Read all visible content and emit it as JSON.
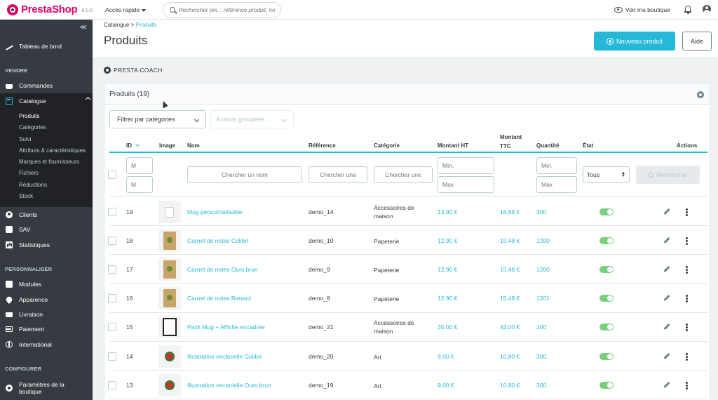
{
  "app": {
    "name": "PrestaShop",
    "version": "8.0.0"
  },
  "topbar": {
    "quick_access": "Accès rapide",
    "search_placeholder": "Rechercher (ex. : référence produit, no",
    "view_shop": "Voir ma boutique"
  },
  "sidebar": {
    "dashboard": "Tableau de bord",
    "section_sell": "VENDRE",
    "orders": "Commandes",
    "catalog": "Catalogue",
    "catalog_sub": [
      "Produits",
      "Catégories",
      "Suivi",
      "Attributs & caractéristiques",
      "Marques et fournisseurs",
      "Fichiers",
      "Réductions",
      "Stock"
    ],
    "customers": "Clients",
    "sav": "SAV",
    "stats": "Statistiques",
    "section_customize": "PERSONNALISER",
    "modules": "Modules",
    "appearance": "Apparence",
    "shipping": "Livraison",
    "payment": "Paiement",
    "international": "International",
    "section_configure": "CONFIGURER",
    "shop_params": "Paramètres de la boutique"
  },
  "header": {
    "breadcrumb_parent": "Catalogue",
    "breadcrumb_sep": ">",
    "breadcrumb_current": "Produits",
    "title": "Produits",
    "new_product": "Nouveau produit",
    "help": "Aide"
  },
  "coach": "PRESTA COACH",
  "card": {
    "title": "Produits (19)",
    "filter_categories": "Filtrer par catégories",
    "bulk_actions": "Actions groupées"
  },
  "table": {
    "headers": {
      "id": "ID",
      "image": "Image",
      "name": "Nom",
      "reference": "Référence",
      "category": "Catégorie",
      "price_ht_label": "Montant HT",
      "price_ttc_l1": "Montant",
      "price_ttc_l2": "TTC",
      "quantity": "Quantité",
      "state": "État",
      "actions": "Actions"
    },
    "filters": {
      "id_min": "M",
      "id_max": "M",
      "name": "Chercher un nom",
      "reference": "Chercher une",
      "category": "Chercher une",
      "price_min": "Min.",
      "price_max": "Max",
      "qty_min": "Min.",
      "qty_max": "Max",
      "state": "Tous",
      "search_button": "Rechercher"
    },
    "rows": [
      {
        "id": "19",
        "name": "Mug personnalisable",
        "reference": "demo_14",
        "category": "Accessoires de maison",
        "price_ht": "13,90 €",
        "price_ttc": "16,68 €",
        "quantity": "300",
        "icon": "mug"
      },
      {
        "id": "18",
        "name": "Carnet de notes Colibri",
        "reference": "demo_10",
        "category": "Papeterie",
        "price_ht": "12,90 €",
        "price_ttc": "15,48 €",
        "quantity": "1200",
        "icon": "notebook"
      },
      {
        "id": "17",
        "name": "Carnet de notes Ours brun",
        "reference": "demo_9",
        "category": "Papeterie",
        "price_ht": "12,90 €",
        "price_ttc": "15,48 €",
        "quantity": "1200",
        "icon": "notebook"
      },
      {
        "id": "16",
        "name": "Carnet de notes Renard",
        "reference": "demo_8",
        "category": "Papeterie",
        "price_ht": "12,90 €",
        "price_ttc": "15,48 €",
        "quantity": "1201",
        "icon": "notebook"
      },
      {
        "id": "15",
        "name": "Pack Mug + Affiche encadrée",
        "reference": "demo_21",
        "category": "Accessoires de maison",
        "price_ht": "35,00 €",
        "price_ttc": "42,00 €",
        "quantity": "100",
        "icon": "frame"
      },
      {
        "id": "14",
        "name": "Illustration vectorielle Colibri",
        "reference": "demo_20",
        "category": "Art",
        "price_ht": "9,00 €",
        "price_ttc": "10,80 €",
        "quantity": "300",
        "icon": "vector"
      },
      {
        "id": "13",
        "name": "Illustration vectorielle Ours brun",
        "reference": "demo_19",
        "category": "Art",
        "price_ht": "9,00 €",
        "price_ttc": "10,80 €",
        "quantity": "300",
        "icon": "vector"
      }
    ]
  },
  "colors": {
    "accent": "#25b9d7",
    "brand": "#df0067",
    "sidebar_bg": "#363a41",
    "toggle_on": "#78d07d"
  }
}
